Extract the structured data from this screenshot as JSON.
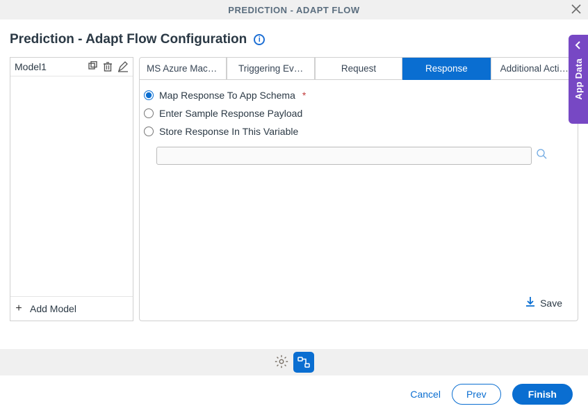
{
  "header": {
    "title": "PREDICTION - ADAPT FLOW"
  },
  "page": {
    "title": "Prediction - Adapt Flow Configuration"
  },
  "drawer": {
    "label": "App Data"
  },
  "sidebar": {
    "item_label": "Model1",
    "add_label": "Add Model"
  },
  "tabs": [
    {
      "label": "MS Azure Machine Lear…",
      "active": false
    },
    {
      "label": "Triggering Ev…",
      "active": false
    },
    {
      "label": "Request",
      "active": false
    },
    {
      "label": "Response",
      "active": true
    },
    {
      "label": "Additional Acti…",
      "active": false
    }
  ],
  "form": {
    "radio1": "Map Response To App Schema",
    "radio2": "Enter Sample Response Payload",
    "radio3": "Store Response In This Variable",
    "save_label": "Save"
  },
  "footer": {
    "cancel": "Cancel",
    "prev": "Prev",
    "finish": "Finish"
  }
}
